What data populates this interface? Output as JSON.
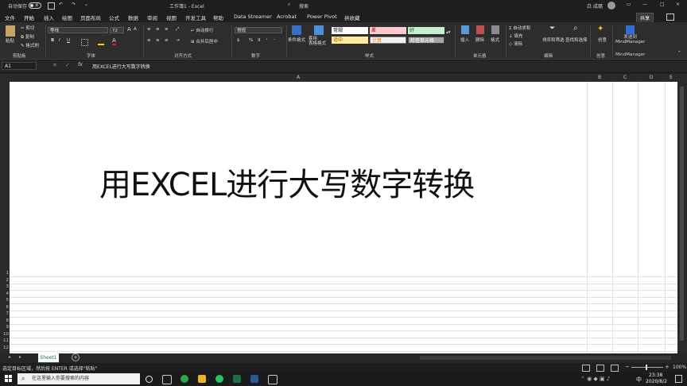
{
  "titlebar": {
    "autosave": "自动保存",
    "autosave_state": "关",
    "doc_title": "工作簿1 - Excel",
    "search_label": "搜索",
    "user": "白 成璐",
    "controls": [
      "—",
      "□",
      "×"
    ]
  },
  "menu": {
    "tabs": [
      "文件",
      "开始",
      "插入",
      "绘图",
      "页面布局",
      "公式",
      "数据",
      "审阅",
      "视图",
      "开发工具",
      "帮助",
      "Data Streamer",
      "Acrobat",
      "Power Pivot",
      "拱收藏"
    ],
    "active": "开始",
    "share": "共享"
  },
  "ribbon": {
    "clipboard": {
      "paste": "粘贴",
      "cut": "剪切",
      "copy": "复制",
      "format_painter": "格式刷",
      "group": "剪贴板"
    },
    "font": {
      "name": "等线",
      "size": "72",
      "bold": "B",
      "italic": "I",
      "underline": "U",
      "group": "字体",
      "grow": "A",
      "shrink": "A"
    },
    "alignment": {
      "wrap": "自动换行",
      "merge": "合并后居中",
      "group": "对齐方式"
    },
    "number": {
      "format": "常规",
      "percent": "%",
      "comma": "9",
      "group": "数字"
    },
    "styles": {
      "conditional": "条件格式",
      "table": "套用\n表格格式",
      "normal": "常规",
      "bad": "差",
      "good": "好",
      "neutral": "适中",
      "calc": "计算",
      "check": "检查单元格",
      "group": "样式"
    },
    "cells": {
      "insert": "插入",
      "delete": "删除",
      "format": "格式",
      "group": "单元格"
    },
    "editing": {
      "autosum": "自动求和",
      "fill": "填充",
      "clear": "清除",
      "sort": "排序和筛选",
      "find": "查找和选择",
      "group": "编辑"
    },
    "ideas": {
      "label": "创意",
      "group": "创意"
    },
    "mindmanager": {
      "send": "发送到\nMindManager",
      "group": "MindManager"
    }
  },
  "formula": {
    "namebox": "A1",
    "fx": "fx",
    "content": "用EXCEL进行大写数字转换"
  },
  "columns": [
    "A",
    "B",
    "C",
    "D",
    "E"
  ],
  "rows": [
    "1",
    "2",
    "3",
    "4",
    "5",
    "6",
    "7",
    "8",
    "9",
    "10",
    "11",
    "12"
  ],
  "cell_text": "用EXCEL进行大写数字转换",
  "sheet": {
    "tab": "Sheet1",
    "add": "+"
  },
  "status": {
    "text": "选定目标区域，然后按 ENTER 或选择\"粘贴\"",
    "zoom": "100%"
  },
  "taskbar": {
    "search_placeholder": "在这里输入你要搜索的内容",
    "time": "23:38",
    "date": "2020/8/2",
    "ime": "中"
  }
}
